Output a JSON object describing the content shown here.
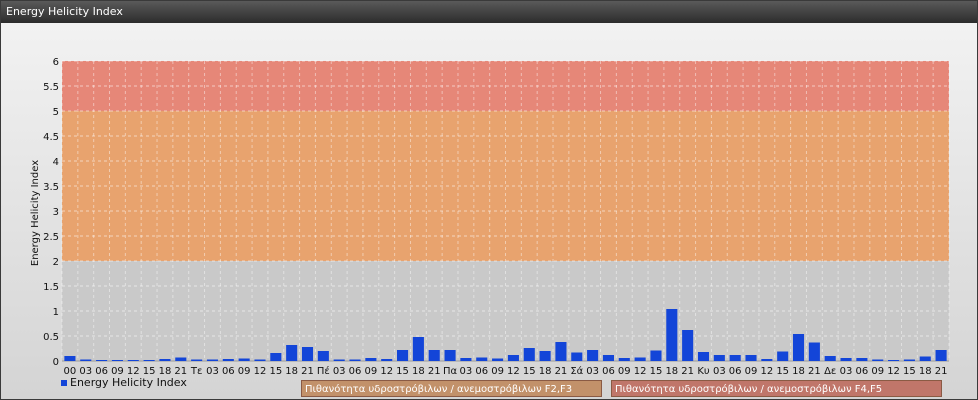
{
  "window": {
    "title": "Energy Helicity Index"
  },
  "legend": {
    "series_label": "Energy Helicity Index",
    "band_labels": [
      "Πιθανότητα υδροστρόβιλων / ανεμοστρόβιλων F2,F3",
      "Πιθανότητα υδροστρόβιλων / ανεμοστρόβιλων F4,F5"
    ]
  },
  "colors": {
    "bar": "#1345d8",
    "band_low": "#c9c9c9",
    "band_mid": "#e8a36e",
    "band_high": "#e68778"
  },
  "chart_data": {
    "type": "bar",
    "title": "Energy Helicity Index",
    "ylabel": "Energy Helicity Index",
    "xlabel": "",
    "ylim": [
      0,
      6
    ],
    "yticks": [
      "0",
      "0.5",
      "1",
      "1.5",
      "2",
      "2.5",
      "3",
      "3.5",
      "4",
      "4.5",
      "5",
      "5.5",
      "6"
    ],
    "grid": true,
    "legend_position": "bottom-left",
    "bands": [
      {
        "from": 2,
        "to": 5,
        "label": "Πιθανότητα υδροστρόβιλων / ανεμοστρόβιλων F2,F3"
      },
      {
        "from": 5,
        "to": 6,
        "label": "Πιθανότητα υδροστρόβιλων / ανεμοστρόβιλων F4,F5"
      }
    ],
    "categories": [
      "00",
      "03",
      "06",
      "09",
      "12",
      "15",
      "18",
      "21",
      "Τε",
      "03",
      "06",
      "09",
      "12",
      "15",
      "18",
      "21",
      "Πέ",
      "03",
      "06",
      "09",
      "12",
      "15",
      "18",
      "21",
      "Πα",
      "03",
      "06",
      "09",
      "12",
      "15",
      "18",
      "21",
      "Σά",
      "03",
      "06",
      "09",
      "12",
      "15",
      "18",
      "21",
      "Κυ",
      "03",
      "06",
      "09",
      "12",
      "15",
      "18",
      "21",
      "Δε",
      "03",
      "06",
      "09",
      "12",
      "15",
      "18",
      "21"
    ],
    "series": [
      {
        "name": "Energy Helicity Index",
        "values": [
          0.1,
          0.03,
          0.02,
          0.02,
          0.02,
          0.02,
          0.04,
          0.07,
          0.03,
          0.03,
          0.04,
          0.05,
          0.03,
          0.16,
          0.32,
          0.28,
          0.2,
          0.03,
          0.03,
          0.06,
          0.04,
          0.22,
          0.48,
          0.22,
          0.22,
          0.06,
          0.07,
          0.05,
          0.12,
          0.26,
          0.2,
          0.38,
          0.17,
          0.22,
          0.12,
          0.06,
          0.07,
          0.21,
          1.04,
          0.62,
          0.18,
          0.12,
          0.12,
          0.12,
          0.04,
          0.19,
          0.54,
          0.37,
          0.1,
          0.06,
          0.06,
          0.03,
          0.02,
          0.03,
          0.09,
          0.22
        ]
      }
    ]
  }
}
